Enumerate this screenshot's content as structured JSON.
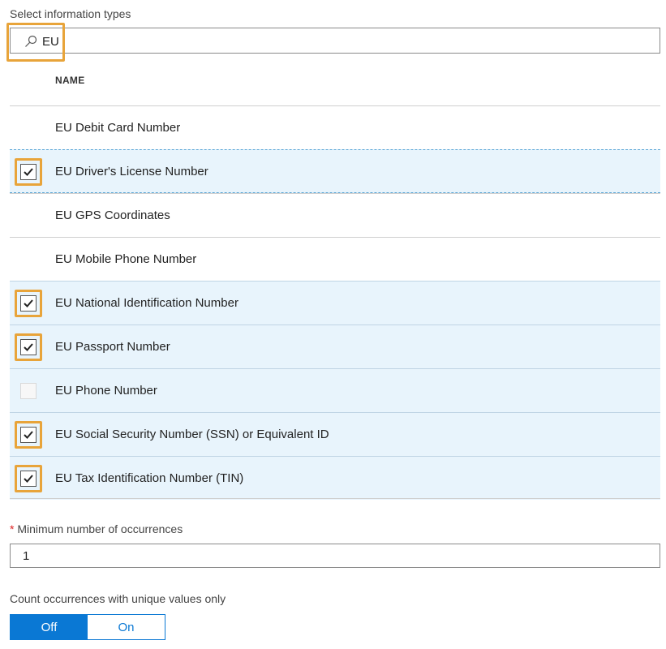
{
  "section_label": "Select information types",
  "search": {
    "value": "EU"
  },
  "table": {
    "column_header": "NAME",
    "rows": [
      {
        "label": "EU Debit Card Number",
        "checked": false,
        "selected": false
      },
      {
        "label": "EU Driver's License Number",
        "checked": true,
        "selected": true
      },
      {
        "label": "EU GPS Coordinates",
        "checked": false,
        "selected": false
      },
      {
        "label": "EU Mobile Phone Number",
        "checked": false,
        "selected": false
      },
      {
        "label": "EU National Identification Number",
        "checked": true,
        "selected": true
      },
      {
        "label": "EU Passport Number",
        "checked": true,
        "selected": true
      },
      {
        "label": "EU Phone Number",
        "checked": false,
        "selected": true
      },
      {
        "label": "EU Social Security Number (SSN) or Equivalent ID",
        "checked": true,
        "selected": true
      },
      {
        "label": "EU Tax Identification Number (TIN)",
        "checked": true,
        "selected": true
      }
    ]
  },
  "min_occurrences": {
    "required_marker": "*",
    "label": "Minimum number of occurrences",
    "value": "1"
  },
  "unique_values": {
    "label": "Count occurrences with unique values only",
    "off_label": "Off",
    "on_label": "On",
    "state": "Off"
  },
  "colors": {
    "accent": "#0a78d4",
    "highlight": "#e8a43a",
    "selected_row": "#e8f4fc"
  }
}
